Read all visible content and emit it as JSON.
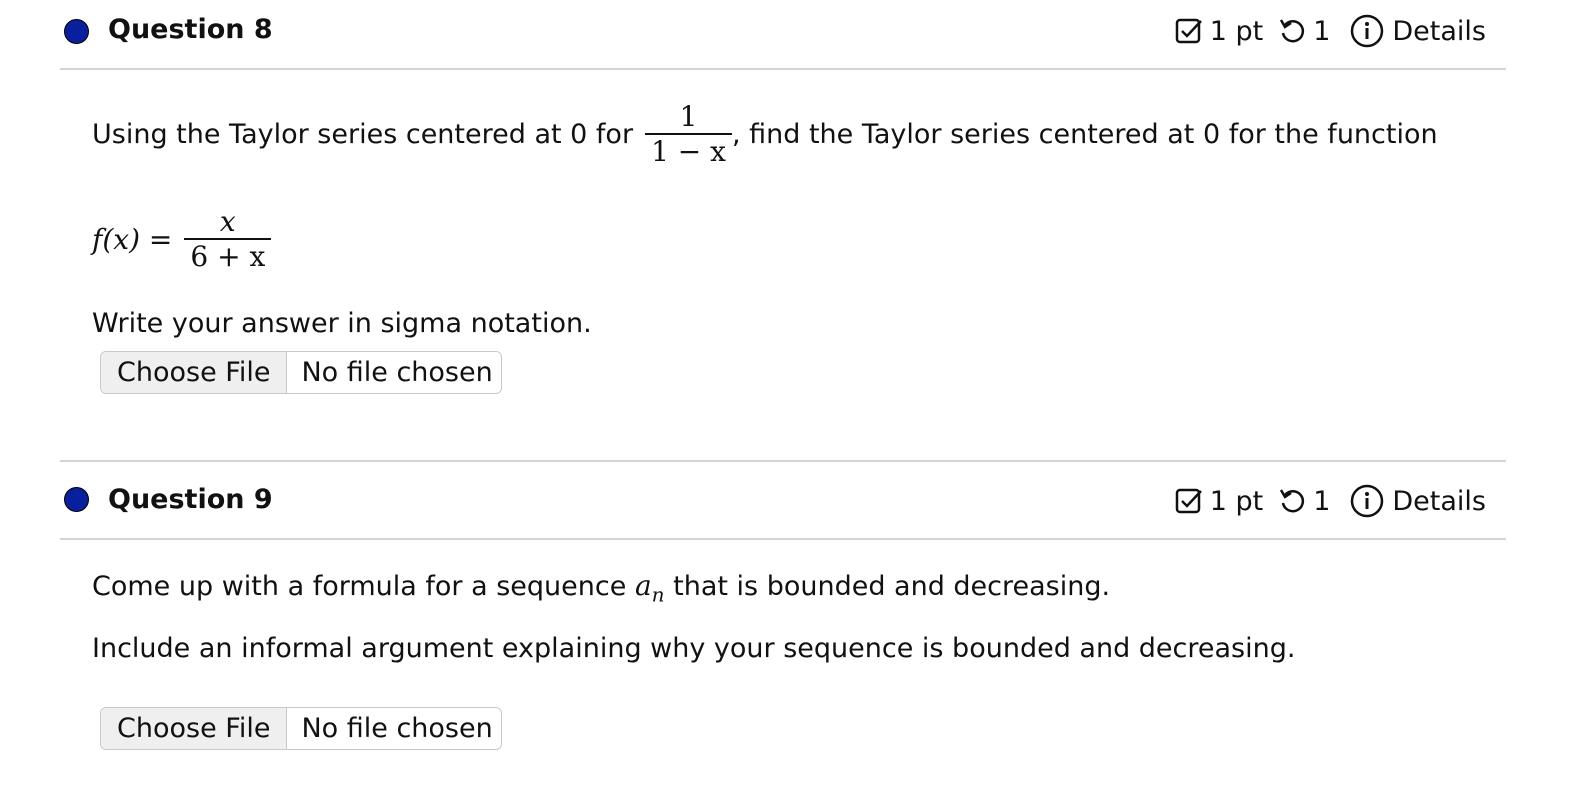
{
  "questions": [
    {
      "title": "Question 8",
      "points": "1 pt",
      "attempts": "1",
      "details_label": "Details",
      "intro_before": "Using the Taylor series centered at 0 for",
      "intro_frac_num": "1",
      "intro_frac_den": "1 − x",
      "intro_after": ", find the Taylor series centered at 0 for the function",
      "func_lhs": "f(x) =",
      "func_num": "x",
      "func_den": "6 + x",
      "instruction": "Write your answer in sigma notation.",
      "file_button": "Choose File",
      "file_status": "No file chosen"
    },
    {
      "title": "Question 9",
      "points": "1 pt",
      "attempts": "1",
      "details_label": "Details",
      "line1_before": "Come up with a formula for a sequence",
      "line1_var": "a",
      "line1_sub": "n",
      "line1_after": "that is bounded and decreasing.",
      "line2": "Include an informal argument explaining why your sequence is bounded and decreasing.",
      "file_button": "Choose File",
      "file_status": "No file chosen"
    }
  ],
  "colors": {
    "status_dot": "#0a1f9e",
    "divider": "#d4d4d4"
  },
  "icons": {
    "points": "checkbox-icon",
    "attempts": "retry-icon",
    "details": "info-icon"
  }
}
